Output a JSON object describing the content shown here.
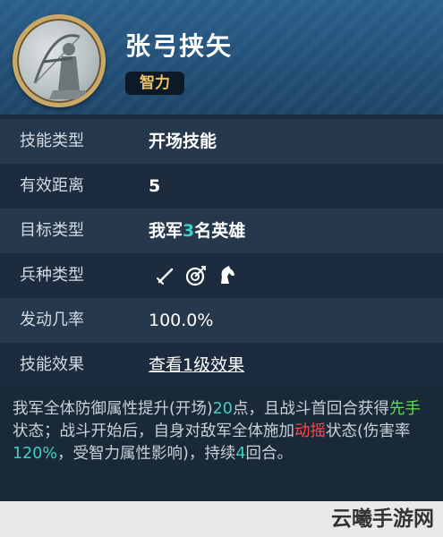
{
  "header": {
    "skill_name": "张弓挟矢",
    "tag": "智力",
    "portrait_icon": "archer-portrait-icon"
  },
  "rows": {
    "skill_type": {
      "label": "技能类型",
      "value": "开场技能"
    },
    "range": {
      "label": "有效距离",
      "value": "5"
    },
    "target": {
      "label": "目标类型",
      "prefix": "我军",
      "count": "3",
      "suffix": "名英雄"
    },
    "troop": {
      "label": "兵种类型",
      "icons": [
        "sword-icon",
        "bow-target-icon",
        "horse-icon"
      ]
    },
    "rate": {
      "label": "发动几率",
      "value": "100.0%"
    },
    "effect": {
      "label": "技能效果",
      "link": "查看1级效果"
    }
  },
  "description": {
    "p1": "我军全体防御属性提升(开场)",
    "v1": "20",
    "p2": "点，且战斗首回合获得",
    "g1": "先手",
    "p3": "状态；战斗开始后，自身对敌军全体施加",
    "r1": "动摇",
    "p4": "状态(伤害率",
    "v2": "120%",
    "p5": "，受智力属性影响)，持续",
    "v3": "4",
    "p6": "回合。"
  },
  "watermark": "云曦手游网",
  "colors": {
    "accent_teal": "#3fd0c4",
    "highlight_green": "#5fe24d",
    "highlight_red": "#ff4a4a",
    "tag_text": "#f0c060",
    "header_blue": "#235178"
  }
}
